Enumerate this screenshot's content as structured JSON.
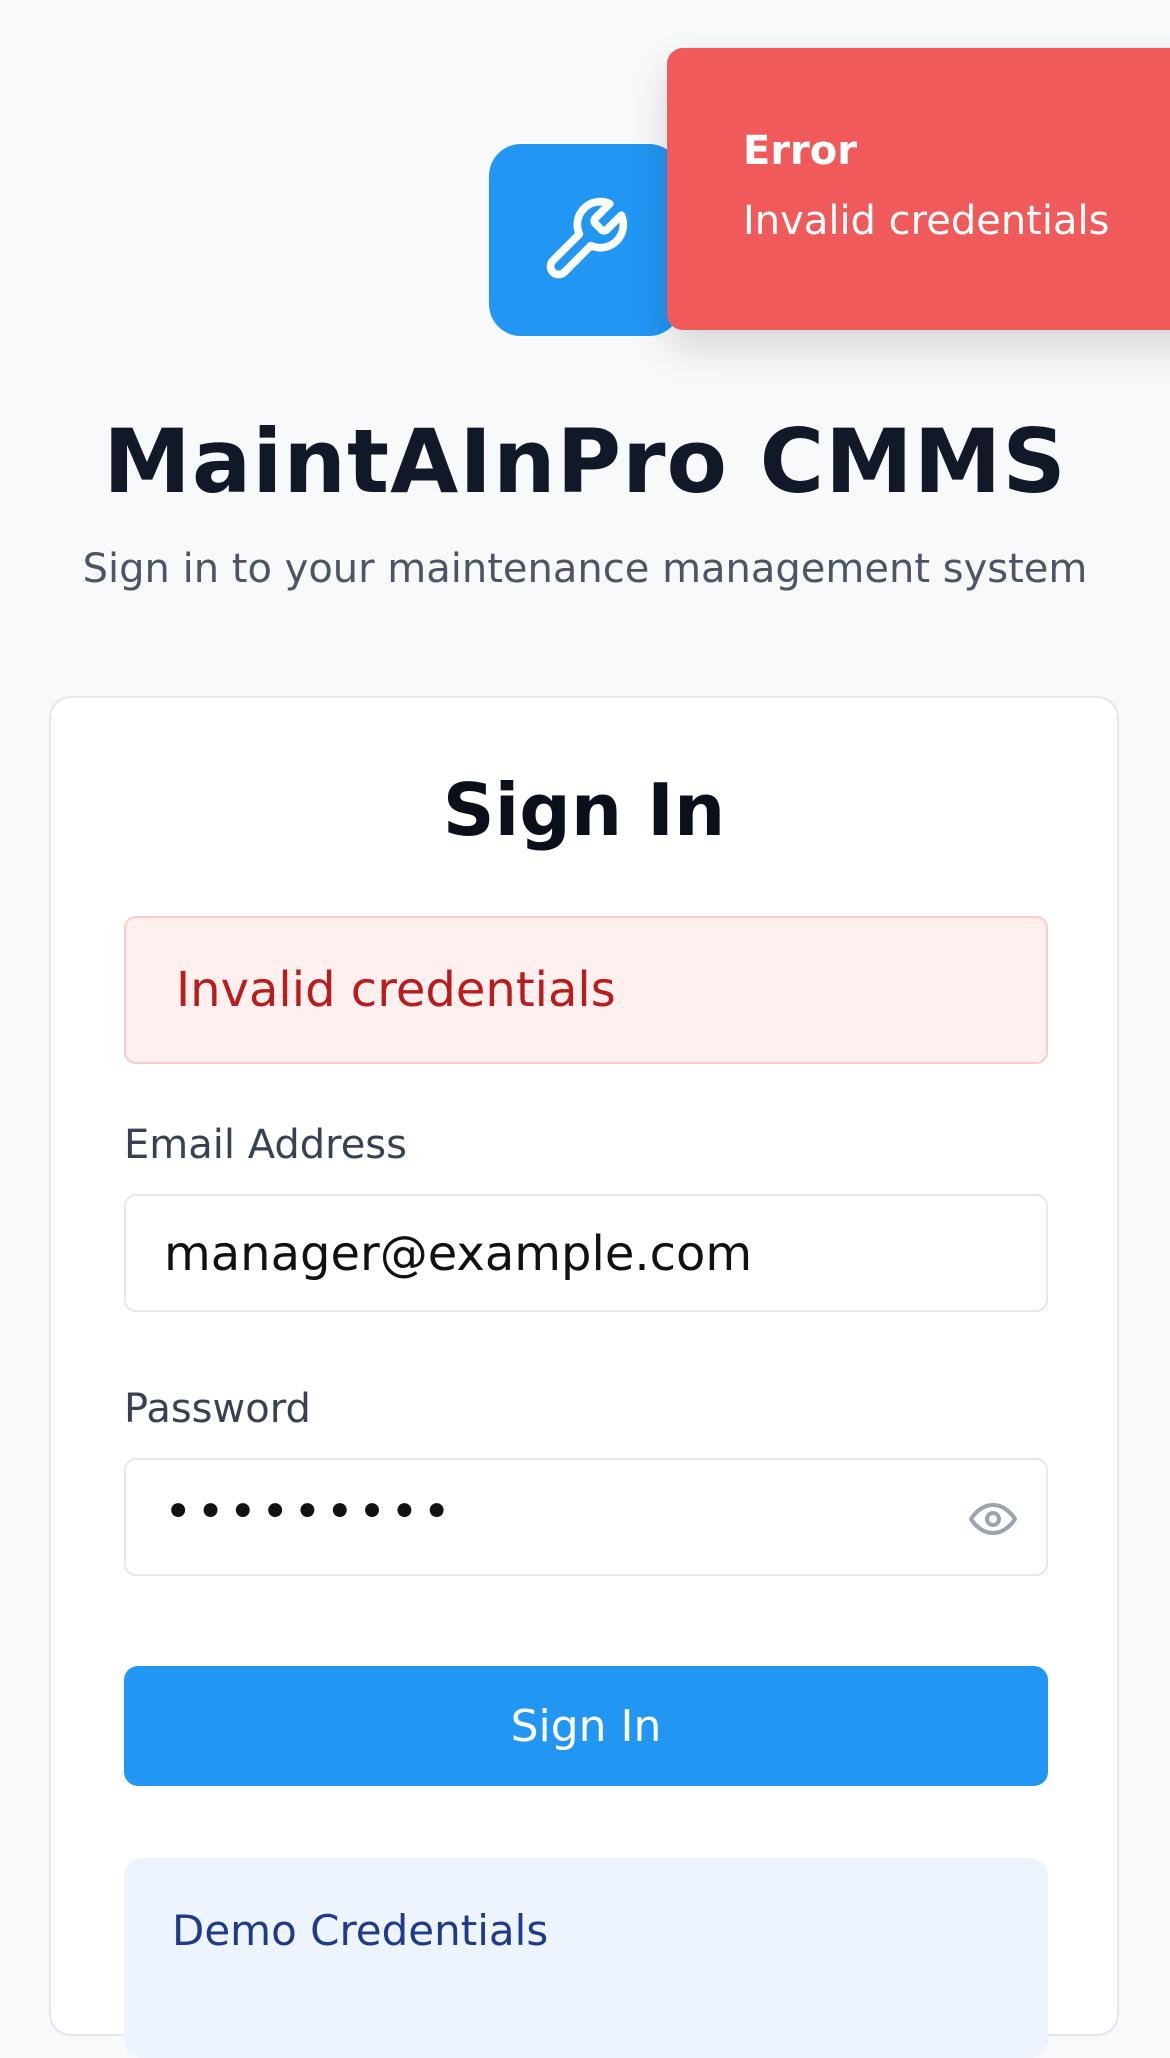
{
  "colors": {
    "background": "#f8f9fb",
    "brand": "#2196f3",
    "toast_error": "#f05a5a",
    "alert_text": "#b91c1c",
    "alert_background": "#fff0f0",
    "demo_title": "#1e3a8a"
  },
  "header": {
    "logo_icon": "wrench-icon",
    "title": "MaintAInPro CMMS",
    "subtitle": "Sign in to your maintenance management system"
  },
  "toast": {
    "title": "Error",
    "message": "Invalid credentials"
  },
  "login": {
    "title": "Sign In",
    "error_message": "Invalid credentials",
    "email_label": "Email Address",
    "email_value": "manager@example.com",
    "password_label": "Password",
    "password_masked": "•••••••••",
    "password_toggle_icon": "eye-icon",
    "submit_label": "Sign In"
  },
  "demo": {
    "title": "Demo Credentials"
  }
}
